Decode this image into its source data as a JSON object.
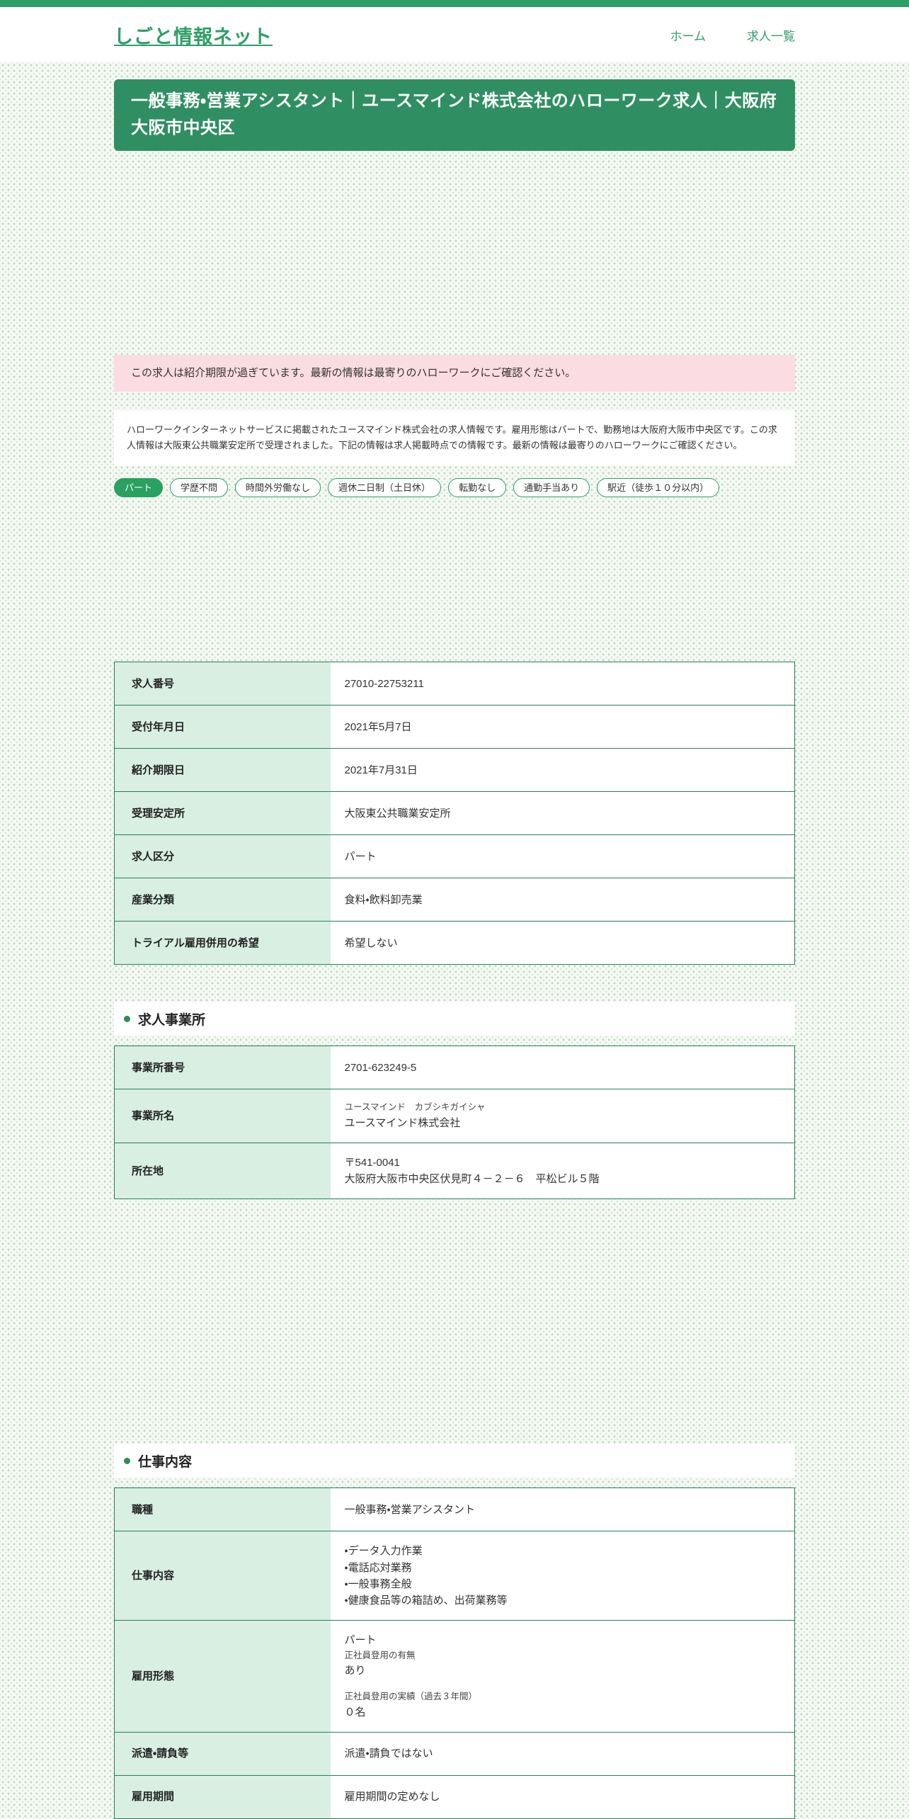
{
  "theme": {
    "accent_green": "#2e9e67",
    "banner_green": "#2f8f62",
    "notice_pink": "#fadce2",
    "label_cell_green": "#d8efe2",
    "table_border_green": "#257f5e"
  },
  "header": {
    "logo": "しごと情報ネット",
    "nav": [
      {
        "label": "ホーム"
      },
      {
        "label": "求人一覧"
      }
    ]
  },
  "page_title": "一般事務・営業アシスタント｜ユースマインド株式会社のハローワーク求人｜大阪府大阪市中央区",
  "notice": "この求人は紹介期限が過ぎています。最新の情報は最寄りのハローワークにご確認ください。",
  "description": "ハローワークインターネットサービスに掲載されたユースマインド株式会社の求人情報です。雇用形態はパートで、勤務地は大阪府大阪市中央区です。この求人情報は大阪東公共職業安定所で受理されました。下記の情報は求人掲載時点での情報です。最新の情報は最寄りのハローワークにご確認ください。",
  "tags": [
    {
      "label": "パート",
      "filled": true
    },
    {
      "label": "学歴不問",
      "filled": false
    },
    {
      "label": "時間外労働なし",
      "filled": false
    },
    {
      "label": "週休二日制（土日休）",
      "filled": false
    },
    {
      "label": "転勤なし",
      "filled": false
    },
    {
      "label": "通勤手当あり",
      "filled": false
    },
    {
      "label": "駅近（徒歩１０分以内）",
      "filled": false
    }
  ],
  "summary_table": {
    "rows": [
      {
        "label": "求人番号",
        "lines": [
          {
            "text": "27010-22753211"
          }
        ]
      },
      {
        "label": "受付年月日",
        "lines": [
          {
            "text": "2021年5月7日"
          }
        ]
      },
      {
        "label": "紹介期限日",
        "lines": [
          {
            "text": "2021年7月31日"
          }
        ]
      },
      {
        "label": "受理安定所",
        "lines": [
          {
            "text": "大阪東公共職業安定所"
          }
        ]
      },
      {
        "label": "求人区分",
        "lines": [
          {
            "text": "パート"
          }
        ]
      },
      {
        "label": "産業分類",
        "lines": [
          {
            "text": "食料・飲料卸売業"
          }
        ]
      },
      {
        "label": "トライアル雇用併用の希望",
        "lines": [
          {
            "text": "希望しない"
          }
        ]
      }
    ]
  },
  "sections": [
    {
      "title": "求人事業所",
      "rows": [
        {
          "label": "事業所番号",
          "lines": [
            {
              "text": "2701-623249-5"
            }
          ]
        },
        {
          "label": "事業所名",
          "lines": [
            {
              "text": "ユースマインド　カブシキガイシャ",
              "small": true
            },
            {
              "text": "ユースマインド株式会社"
            }
          ]
        },
        {
          "label": "所在地",
          "lines": [
            {
              "text": "〒541-0041"
            },
            {
              "text": "大阪府大阪市中央区伏見町４－２－６　平松ビル５階"
            }
          ]
        }
      ]
    },
    {
      "title": "仕事内容",
      "rows": [
        {
          "label": "職種",
          "lines": [
            {
              "text": "一般事務・営業アシスタント"
            }
          ]
        },
        {
          "label": "仕事内容",
          "lines": [
            {
              "text": "・データ入力作業"
            },
            {
              "text": "・電話応対業務"
            },
            {
              "text": "・一般事務全般"
            },
            {
              "text": "・健康食品等の箱詰め、出荷業務等"
            }
          ]
        },
        {
          "label": "雇用形態",
          "lines": [
            {
              "text": "パート"
            },
            {
              "text": "正社員登用の有無",
              "small": true
            },
            {
              "text": "あり"
            },
            {
              "text": "正社員登用の実績（過去３年間）",
              "small": true,
              "gap_before": true
            },
            {
              "text": "０名"
            }
          ]
        },
        {
          "label": "派遣・請負等",
          "lines": [
            {
              "text": "派遣・請負ではない"
            }
          ]
        },
        {
          "label": "雇用期間",
          "lines": [
            {
              "text": "雇用期間の定めなし"
            }
          ]
        }
      ]
    }
  ]
}
